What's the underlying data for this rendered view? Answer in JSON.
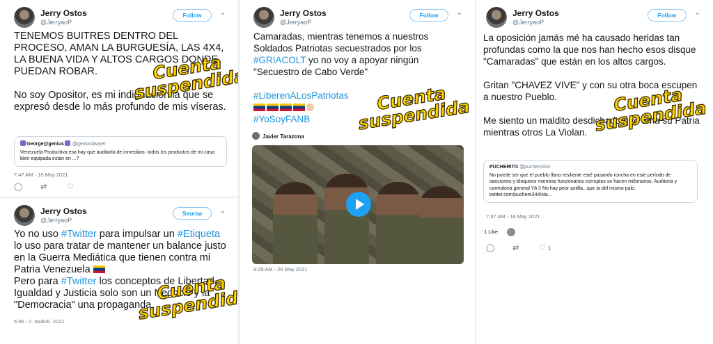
{
  "colors": {
    "link": "#1b95e0",
    "stamp_fill": "#ffd400",
    "stamp_outline": "#3a2a00"
  },
  "stamp": {
    "line1": "Cuenta",
    "line2": "suspendida"
  },
  "tweets": [
    {
      "name": "Jerry Ostos",
      "handle": "@JerryaoP",
      "follow_label": "Follow",
      "text": [
        "TENEMOS BUITRES DENTRO DEL PROCESO, AMAN LA BURGUESÍA, LAS 4X4, LA BUENA VIDA Y ALTOS CARGOS DONDE PUEDAN ROBAR.",
        "No soy Opositor, es mi indignación la que se expresó desde lo más profundo de mis víseras."
      ],
      "quote": {
        "name": "George@genius",
        "handle": "@geniuslawyer",
        "text": "Venezuela Productiva esa hay que auditarla de inmediato, todos los productos de mi casa bien equipada estan en ...?"
      },
      "timestamp": "7:47 AM - 16 May 2021",
      "actions": [
        "reply-icon",
        "retweet-icon",
        "like-icon"
      ]
    },
    {
      "name": "Jerry Ostos",
      "handle": "@JerryaoP",
      "follow_label": "Seuraa",
      "text_parts": {
        "a1": "Yo no uso ",
        "t1": "#Twitter",
        "a2": " para impulsar un",
        "t2": "#Etiqueta",
        "a3": " lo uso para tratar de mantener un balance justo en la Guerra Mediática que tienen contra mi Patria Venezuela",
        "a4": "Pero para ",
        "t3": "#Twitter",
        "a5": " los conceptos de Libertad, Igualdad y Justicia solo son un Negocio y la \"Democracia\" una propaganda"
      },
      "timestamp": "6.56 - 2. toukok. 2021"
    },
    {
      "name": "Jerry Ostos",
      "handle": "@JerryaoP",
      "follow_label": "Follow",
      "text_parts": {
        "a1": "Camaradas, mientras tenemos a nuestros Soldados Patriotas secuestrados por los ",
        "t1": "#GRIACOLT",
        "a2": " yo no voy a apoyar ningún \"Secuestro de Cabo Verde\"",
        "t2": "#LiberenALosPatriotas",
        "t3": "#YoSoyFANB"
      },
      "media_author": "Javier Tarazona",
      "timestamp": "9:29 AM - 26 May 2021"
    },
    {
      "name": "Jerry Ostos",
      "handle": "@JerryaoP",
      "follow_label": "Follow",
      "text": [
        "La oposición jamás mé ha causado heridas tan profundas como la que nos han hecho esos disque \"Camaradas\" que están en los altos cargos.",
        "Gritan \"CHAVEZ VIVE\" y con su otra boca escupen a nuestro Pueblo.",
        "Me siento un maldito desdichado que ama su Patria mientras otros La Violan."
      ],
      "quote": {
        "name": "PUCHERITO",
        "handle": "@puchero344",
        "text": "No puede ser que el pueblo llano resiliente esté pasando roncha en este período de sanciones y bloqueos mientras funcionarios corruptos se hacen millonarios. Auditoria y contraloria general YA !! No hay peor astilla...que la del mismo palo. twitter.com/puchero344/sta..."
      },
      "timestamp": "7:37 AM - 16 May 2021",
      "likes": "1 Like",
      "reply_count": "1"
    }
  ]
}
